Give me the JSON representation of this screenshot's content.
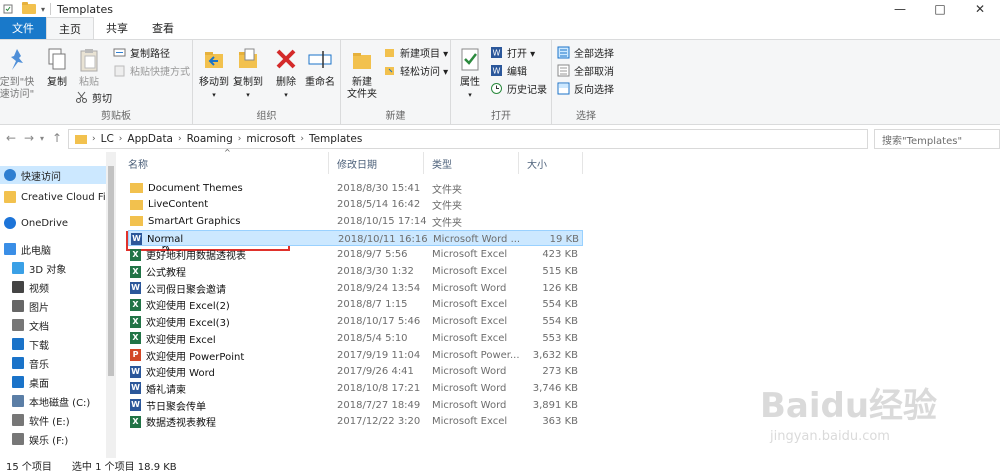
{
  "window": {
    "title": "Templates",
    "controls": [
      "—",
      "□",
      "✕"
    ]
  },
  "tabs": [
    {
      "label": "文件",
      "style": "file"
    },
    {
      "label": "主页",
      "style": "active"
    },
    {
      "label": "共享",
      "style": ""
    },
    {
      "label": "查看",
      "style": ""
    }
  ],
  "ribbon": {
    "clipboard": {
      "label": "剪贴板",
      "pin_label_line1": "定到\"快",
      "pin_label_line2": "速访问\"",
      "copy": "复制",
      "paste": "粘贴",
      "copy_path": "复制路径",
      "paste_shortcut": "粘贴快捷方式",
      "cut": "剪切"
    },
    "organize": {
      "label": "组织",
      "move_to": "移动到",
      "copy_to": "复制到",
      "delete": "删除",
      "rename": "重命名"
    },
    "new": {
      "label": "新建",
      "new_folder_line1": "新建",
      "new_folder_line2": "文件夹",
      "new_item": "新建项目 ▾",
      "easy_access": "轻松访问 ▾"
    },
    "open": {
      "label": "打开",
      "properties": "属性",
      "open": "打开 ▾",
      "edit": "编辑",
      "history": "历史记录"
    },
    "select": {
      "label": "选择",
      "select_all": "全部选择",
      "select_none": "全部取消",
      "invert": "反向选择"
    }
  },
  "address": {
    "breadcrumbs": [
      "LC",
      "AppData",
      "Roaming",
      "microsoft",
      "Templates"
    ],
    "search_placeholder": "搜索\"Templates\""
  },
  "nav": {
    "items": [
      {
        "label": "快速访问",
        "icon": "star-icon",
        "color": "#2f7fd1",
        "selected": true
      },
      {
        "label": "Creative Cloud Fi",
        "icon": "cloud-folder-icon",
        "color": "#f2c14e",
        "selected": false
      },
      {
        "label": "OneDrive",
        "icon": "cloud-icon",
        "color": "#1d74d8",
        "selected": false
      },
      {
        "label": "此电脑",
        "icon": "computer-icon",
        "color": "#3a8ee6",
        "selected": false
      },
      {
        "label": "3D 对象",
        "icon": "cube-icon",
        "color": "#3aa0e6",
        "selected": false
      },
      {
        "label": "视频",
        "icon": "video-icon",
        "color": "#444",
        "selected": false
      },
      {
        "label": "图片",
        "icon": "picture-icon",
        "color": "#666",
        "selected": false
      },
      {
        "label": "文档",
        "icon": "document-icon",
        "color": "#777",
        "selected": false
      },
      {
        "label": "下载",
        "icon": "download-icon",
        "color": "#1a73c9",
        "selected": false
      },
      {
        "label": "音乐",
        "icon": "music-icon",
        "color": "#1a73c9",
        "selected": false
      },
      {
        "label": "桌面",
        "icon": "desktop-icon",
        "color": "#1a73c9",
        "selected": false
      },
      {
        "label": "本地磁盘 (C:)",
        "icon": "drive-icon",
        "color": "#5b7ea6",
        "selected": false
      },
      {
        "label": "软件 (E:)",
        "icon": "drive-icon",
        "color": "#777",
        "selected": false
      },
      {
        "label": "娱乐 (F:)",
        "icon": "drive-icon",
        "color": "#777",
        "selected": false
      }
    ]
  },
  "columns": {
    "name": "名称",
    "date": "修改日期",
    "type": "类型",
    "size": "大小"
  },
  "files": [
    {
      "name": "Document Themes",
      "date": "2018/8/30 15:41",
      "type": "文件夹",
      "size": "",
      "kind": "folder"
    },
    {
      "name": "LiveContent",
      "date": "2018/5/14 16:42",
      "type": "文件夹",
      "size": "",
      "kind": "folder"
    },
    {
      "name": "SmartArt Graphics",
      "date": "2018/10/15 17:14",
      "type": "文件夹",
      "size": "",
      "kind": "folder"
    },
    {
      "name": "Normal",
      "date": "2018/10/11 16:16",
      "type": "Microsoft Word ...",
      "size": "19 KB",
      "kind": "word",
      "selected": true
    },
    {
      "name": "更好地利用数据透视表",
      "date": "2018/9/7 5:56",
      "type": "Microsoft Excel",
      "size": "423 KB",
      "kind": "excel"
    },
    {
      "name": "公式教程",
      "date": "2018/3/30 1:32",
      "type": "Microsoft Excel",
      "size": "515 KB",
      "kind": "excel"
    },
    {
      "name": "公司假日聚会邀请",
      "date": "2018/9/24 13:54",
      "type": "Microsoft Word",
      "size": "126 KB",
      "kind": "word"
    },
    {
      "name": "欢迎使用 Excel(2)",
      "date": "2018/8/7 1:15",
      "type": "Microsoft Excel",
      "size": "554 KB",
      "kind": "excel"
    },
    {
      "name": "欢迎使用 Excel(3)",
      "date": "2018/10/17 5:46",
      "type": "Microsoft Excel",
      "size": "554 KB",
      "kind": "excel"
    },
    {
      "name": "欢迎使用 Excel",
      "date": "2018/5/4 5:10",
      "type": "Microsoft Excel",
      "size": "553 KB",
      "kind": "excel"
    },
    {
      "name": "欢迎使用 PowerPoint",
      "date": "2017/9/19 11:04",
      "type": "Microsoft Power...",
      "size": "3,632 KB",
      "kind": "ppt"
    },
    {
      "name": "欢迎使用 Word",
      "date": "2017/9/26 4:41",
      "type": "Microsoft Word",
      "size": "273 KB",
      "kind": "word"
    },
    {
      "name": "婚礼请柬",
      "date": "2018/10/8 17:21",
      "type": "Microsoft Word",
      "size": "3,746 KB",
      "kind": "word"
    },
    {
      "name": "节日聚会传单",
      "date": "2018/7/27 18:49",
      "type": "Microsoft Word",
      "size": "3,891 KB",
      "kind": "word"
    },
    {
      "name": "数据透视表教程",
      "date": "2017/12/22 3:20",
      "type": "Microsoft Excel",
      "size": "363 KB",
      "kind": "excel"
    }
  ],
  "status": {
    "count": "15 个项目",
    "selected": "选中 1 个项目  18.9 KB"
  },
  "watermark": {
    "logo": "Baidu经验",
    "url": "jingyan.baidu.com"
  },
  "colors": {
    "accent": "#1979ca",
    "selection": "#cce8ff",
    "highlight_box": "#e0312b",
    "folder": "#f2c14e",
    "word": "#2b579a",
    "excel": "#217346",
    "ppt": "#d24726"
  }
}
